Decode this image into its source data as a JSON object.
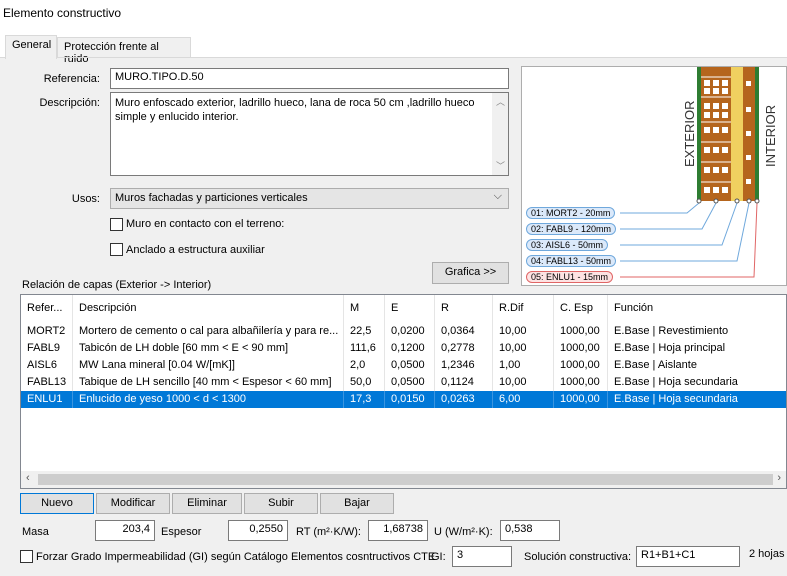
{
  "window": {
    "title": "Elemento constructivo"
  },
  "tabs": [
    {
      "label": "General"
    },
    {
      "label": "Protección frente al ruido"
    }
  ],
  "form": {
    "referencia_label": "Referencia:",
    "referencia_value": "MURO.TIPO.D.50",
    "descripcion_label": "Descripción:",
    "descripcion_value": "Muro enfoscado exterior, ladrillo hueco, lana de roca 50 cm ,ladrillo hueco simple y enlucido interior.",
    "usos_label": "Usos:",
    "usos_value": "Muros fachadas y particiones verticales",
    "terreno_label": "Muro en contacto con el terreno:",
    "anclado_label": "Anclado a estructura auxiliar",
    "grafica_button": "Grafica >>"
  },
  "preview": {
    "exterior_label": "EXTERIOR",
    "interior_label": "INTERIOR",
    "layers": [
      "01: MORT2 - 20mm",
      "02: FABL9 - 120mm",
      "03: AISL6 - 50mm",
      "04: FABL13 - 50mm",
      "05: ENLU1 - 15mm"
    ],
    "colors": {
      "brick": "#b5651d",
      "mortar": "#2e7d32",
      "insulation": "#f0d060",
      "plaster": "#e8e0c8"
    }
  },
  "layers_section": {
    "title": "Relación de capas (Exterior -> Interior)",
    "columns": [
      "Refer...",
      "Descripción",
      "M",
      "E",
      "R",
      "R.Dif",
      "C. Esp",
      "Función"
    ],
    "rows": [
      [
        "MORT2",
        "Mortero de cemento o cal para albañilería y para re...",
        "22,5",
        "0,0200",
        "0,0364",
        "10,00",
        "1000,00",
        "E.Base | Revestimiento"
      ],
      [
        "FABL9",
        "Tabicón de LH doble [60 mm < E < 90 mm]",
        "111,6",
        "0,1200",
        "0,2778",
        "10,00",
        "1000,00",
        "E.Base | Hoja principal"
      ],
      [
        "AISL6",
        "MW Lana mineral [0.04 W/[mK]]",
        "2,0",
        "0,0500",
        "1,2346",
        "1,00",
        "1000,00",
        "E.Base | Aislante"
      ],
      [
        "FABL13",
        "Tabique de LH sencillo [40 mm < Espesor < 60 mm]",
        "50,0",
        "0,0500",
        "0,1124",
        "10,00",
        "1000,00",
        "E.Base | Hoja secundaria"
      ],
      [
        "ENLU1",
        "Enlucido de yeso 1000 < d < 1300",
        "17,3",
        "0,0150",
        "0,0263",
        "6,00",
        "1000,00",
        "E.Base | Hoja secundaria"
      ]
    ],
    "selected_row": 4
  },
  "actions": {
    "nuevo": "Nuevo",
    "modificar": "Modificar",
    "eliminar": "Eliminar",
    "subir": "Subir",
    "bajar": "Bajar"
  },
  "summary": {
    "masa_label": "Masa",
    "masa_value": "203,4",
    "espesor_label": "Espesor",
    "espesor_value": "0,2550",
    "rt_label": "RT (m²·K/W):",
    "rt_value": "1,68738",
    "u_label": "U (W/m²·K):",
    "u_value": "0,538",
    "forzar_label": "Forzar Grado Impermeabilidad (GI) según Catálogo Elementos cosntructivos CTE",
    "gi_label": "GI:",
    "gi_value": "3",
    "solucion_label": "Solución constructiva:",
    "solucion_value": "R1+B1+C1",
    "hojas_label": "2 hojas"
  }
}
